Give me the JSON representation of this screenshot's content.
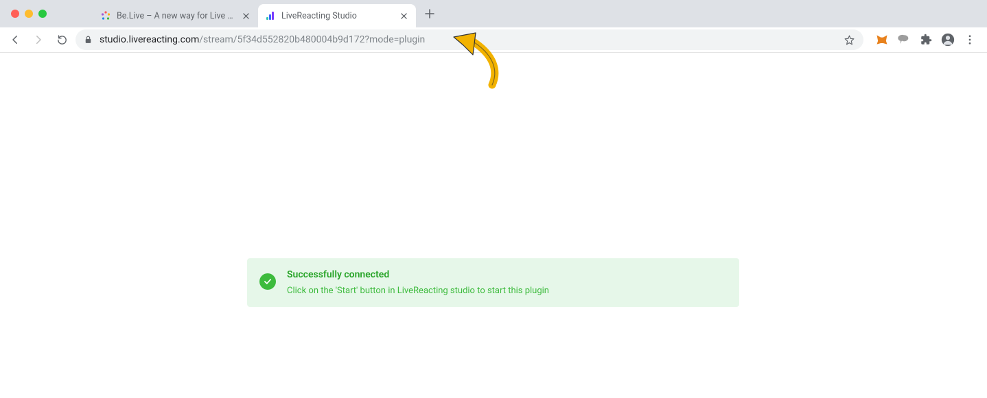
{
  "window": {
    "traffic_lights": [
      "close",
      "minimize",
      "zoom"
    ]
  },
  "tabs": [
    {
      "title": "Be.Live – A new way for Live St",
      "active": false
    },
    {
      "title": "LiveReacting Studio",
      "active": true
    }
  ],
  "new_tab_label": "+",
  "toolbar": {
    "url_host": "studio.livereacting.com",
    "url_path": "/stream/5f34d552820b480004b9d172?mode=plugin"
  },
  "alert": {
    "title": "Successfully connected",
    "subtitle": "Click on the 'Start' button in LiveReacting studio to start this plugin"
  }
}
